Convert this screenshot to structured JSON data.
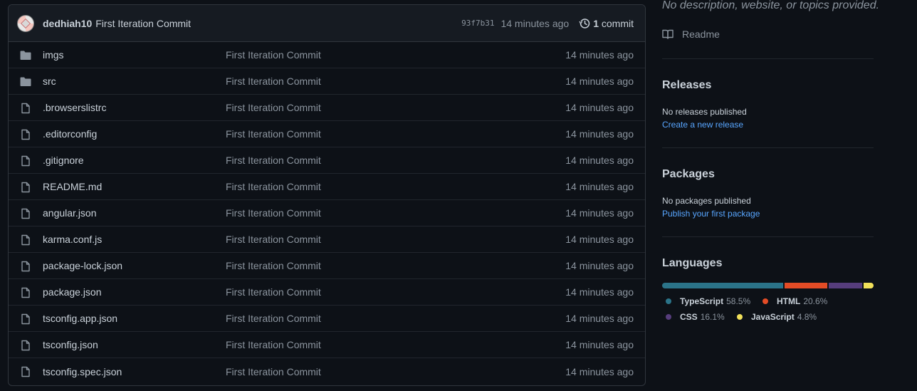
{
  "commit": {
    "author": "dedhiah10",
    "message": "First Iteration Commit",
    "sha": "93f7b31",
    "time": "14 minutes ago",
    "count": "1",
    "count_label": "commit"
  },
  "files": [
    {
      "name": "imgs",
      "type": "folder",
      "message": "First Iteration Commit",
      "time": "14 minutes ago"
    },
    {
      "name": "src",
      "type": "folder",
      "message": "First Iteration Commit",
      "time": "14 minutes ago"
    },
    {
      "name": ".browserslistrc",
      "type": "file",
      "message": "First Iteration Commit",
      "time": "14 minutes ago"
    },
    {
      "name": ".editorconfig",
      "type": "file",
      "message": "First Iteration Commit",
      "time": "14 minutes ago"
    },
    {
      "name": ".gitignore",
      "type": "file",
      "message": "First Iteration Commit",
      "time": "14 minutes ago"
    },
    {
      "name": "README.md",
      "type": "file",
      "message": "First Iteration Commit",
      "time": "14 minutes ago"
    },
    {
      "name": "angular.json",
      "type": "file",
      "message": "First Iteration Commit",
      "time": "14 minutes ago"
    },
    {
      "name": "karma.conf.js",
      "type": "file",
      "message": "First Iteration Commit",
      "time": "14 minutes ago"
    },
    {
      "name": "package-lock.json",
      "type": "file",
      "message": "First Iteration Commit",
      "time": "14 minutes ago"
    },
    {
      "name": "package.json",
      "type": "file",
      "message": "First Iteration Commit",
      "time": "14 minutes ago"
    },
    {
      "name": "tsconfig.app.json",
      "type": "file",
      "message": "First Iteration Commit",
      "time": "14 minutes ago"
    },
    {
      "name": "tsconfig.json",
      "type": "file",
      "message": "First Iteration Commit",
      "time": "14 minutes ago"
    },
    {
      "name": "tsconfig.spec.json",
      "type": "file",
      "message": "First Iteration Commit",
      "time": "14 minutes ago"
    }
  ],
  "sidebar": {
    "about_description": "No description, website, or topics provided.",
    "readme_label": "Readme",
    "releases": {
      "title": "Releases",
      "status": "No releases published",
      "link": "Create a new release"
    },
    "packages": {
      "title": "Packages",
      "status": "No packages published",
      "link": "Publish your first package"
    },
    "languages": {
      "title": "Languages",
      "items": [
        {
          "name": "TypeScript",
          "percent": "58.5%",
          "value": 58.5,
          "color": "#2b7489"
        },
        {
          "name": "HTML",
          "percent": "20.6%",
          "value": 20.6,
          "color": "#e34c26"
        },
        {
          "name": "CSS",
          "percent": "16.1%",
          "value": 16.1,
          "color": "#563d7c"
        },
        {
          "name": "JavaScript",
          "percent": "4.8%",
          "value": 4.8,
          "color": "#f1e05a"
        }
      ]
    }
  },
  "icons": {
    "folder": "folder-icon",
    "file": "file-icon",
    "history": "history-icon",
    "book": "book-icon"
  },
  "colors": {
    "background": "#0d1117",
    "header_bg": "#161b22",
    "border": "#30363d",
    "folder_icon": "#8b949e",
    "link": "#58a6ff"
  }
}
